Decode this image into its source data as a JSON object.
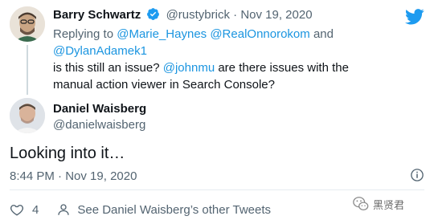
{
  "parent_tweet": {
    "author_name": "Barry Schwartz",
    "handle": "@rustybrick",
    "separator": "·",
    "date": "Nov 19, 2020",
    "replying_prefix": "Replying to",
    "replying_to": [
      "@Marie_Haynes",
      "@RealOnnorokom",
      "and",
      "@DylanAdamek1"
    ],
    "text_before": "is this still an issue?",
    "mention": "@johnmu",
    "text_after": "are there issues with the manual action viewer in Search Console?"
  },
  "main_tweet": {
    "author_name": "Daniel Waisberg",
    "handle": "@danielwaisberg",
    "text": "Looking into it…",
    "time": "8:44 PM",
    "separator": "·",
    "date": "Nov 19, 2020",
    "like_count": "4",
    "other_tweets_link": "See Daniel Waisberg’s other Tweets"
  },
  "watermark": {
    "label": "黑贤君"
  },
  "colors": {
    "accent": "#1b95e0",
    "muted": "#536471",
    "text": "#0f1419",
    "verified": "#1d9bf0",
    "divider": "#e6ecf0"
  }
}
